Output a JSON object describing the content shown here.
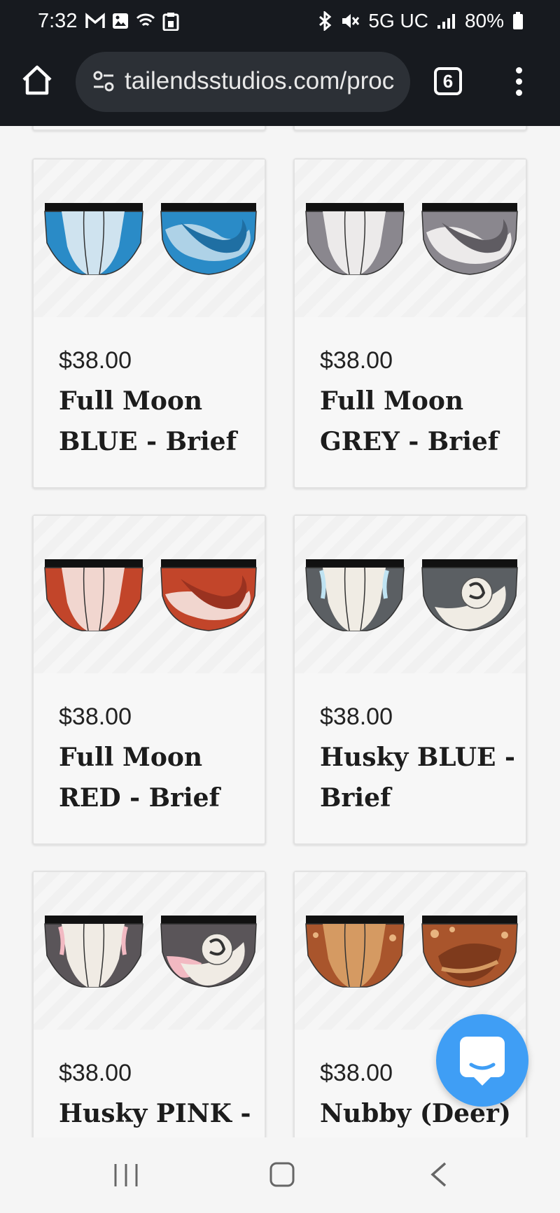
{
  "status": {
    "time": "7:32",
    "network": "5G UC",
    "battery": "80%",
    "icons": [
      "gmail-icon",
      "gallery-icon",
      "wifi-icon",
      "clipboard-icon",
      "bluetooth-icon",
      "mute-icon",
      "signal-icon",
      "battery-icon"
    ]
  },
  "browser": {
    "url": "tailendsstudios.com/proc",
    "tab_count": "6"
  },
  "products": [
    {
      "price": "$38.00",
      "name": "Full Moon BLUE - Brief",
      "colors": {
        "main": "#2a8bc7",
        "light": "#cfe3ef"
      }
    },
    {
      "price": "$38.00",
      "name": "Full Moon GREY - Brief",
      "colors": {
        "main": "#8a878e",
        "light": "#eceaea"
      }
    },
    {
      "price": "$38.00",
      "name": "Full Moon RED - Brief",
      "colors": {
        "main": "#c2452a",
        "light": "#f1d6cf"
      }
    },
    {
      "price": "$38.00",
      "name": "Husky BLUE - Brief",
      "colors": {
        "main": "#5b5f63",
        "light": "#f0ece4"
      }
    },
    {
      "price": "$38.00",
      "name": "Husky PINK -",
      "colors": {
        "main": "#5a5559",
        "light": "#f0ebe4"
      }
    },
    {
      "price": "$38.00",
      "name": "Nubby (Deer) -",
      "colors": {
        "main": "#a9552c",
        "light": "#d59a62"
      }
    }
  ],
  "accent": "#3f9ef5"
}
